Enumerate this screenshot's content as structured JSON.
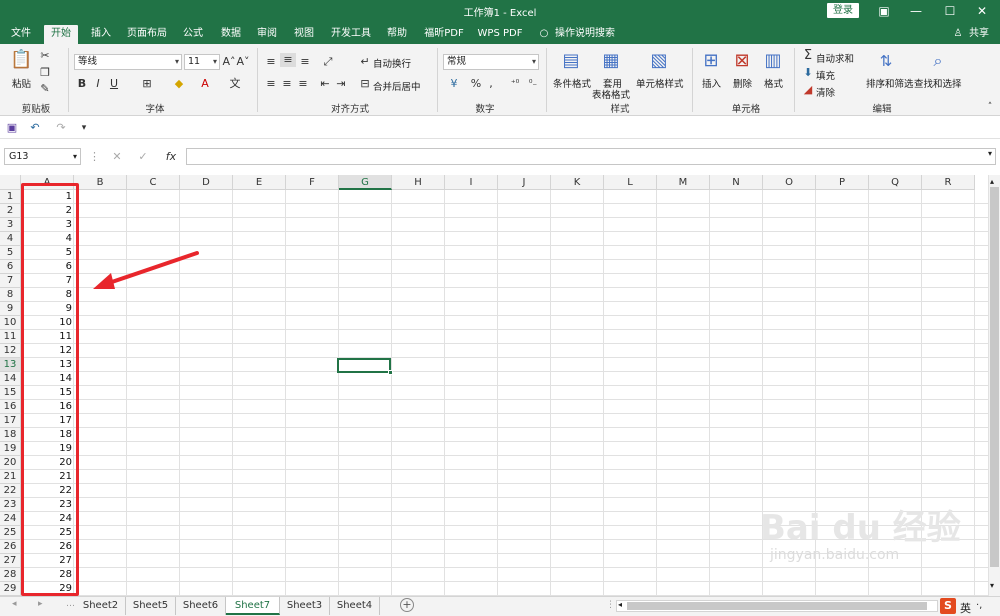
{
  "window": {
    "title": "工作簿1  -  Excel",
    "login_label": "登录",
    "accent": "#217346"
  },
  "menu_tabs": [
    {
      "label": "文件"
    },
    {
      "label": "开始"
    },
    {
      "label": "插入"
    },
    {
      "label": "页面布局"
    },
    {
      "label": "公式"
    },
    {
      "label": "数据"
    },
    {
      "label": "审阅"
    },
    {
      "label": "视图"
    },
    {
      "label": "开发工具"
    },
    {
      "label": "帮助"
    },
    {
      "label": "福昕PDF"
    },
    {
      "label": "WPS PDF"
    },
    {
      "label": "操作说明搜索"
    }
  ],
  "share_label": "共享",
  "ribbon": {
    "clipboard": {
      "paste": "粘贴",
      "group": "剪贴板"
    },
    "font": {
      "name": "等线",
      "size": "11",
      "group": "字体",
      "bold": "B",
      "italic": "I",
      "underline": "U"
    },
    "alignment": {
      "wrap": "自动换行",
      "merge": "合并后居中",
      "group": "对齐方式"
    },
    "number": {
      "format": "常规",
      "percent": "%",
      "comma": ",",
      "group": "数字"
    },
    "styles": {
      "cond": "条件格式",
      "table1": "套用",
      "table2": "表格格式",
      "cell_style": "单元格样式",
      "group": "样式"
    },
    "cells": {
      "insert": "插入",
      "delete": "删除",
      "format": "格式",
      "group": "单元格"
    },
    "editing": {
      "autosum": "自动求和",
      "fill": "填充",
      "clear": "清除",
      "sort": "排序和筛选",
      "find": "查找和选择",
      "group": "编辑"
    }
  },
  "formula_bar": {
    "name_box": "G13",
    "fx": "fx",
    "value": ""
  },
  "columns": [
    "A",
    "B",
    "C",
    "D",
    "E",
    "F",
    "G",
    "H",
    "I",
    "J",
    "K",
    "L",
    "M",
    "N",
    "O",
    "P",
    "Q",
    "R"
  ],
  "selected_column": "G",
  "selected_row": "13",
  "rows": [
    "1",
    "2",
    "3",
    "4",
    "5",
    "6",
    "7",
    "8",
    "9",
    "10",
    "11",
    "12",
    "13",
    "14",
    "15",
    "16",
    "17",
    "18",
    "19",
    "20",
    "21",
    "22",
    "23",
    "24",
    "25",
    "26",
    "27",
    "28",
    "29"
  ],
  "column_a_values": [
    "1",
    "2",
    "3",
    "4",
    "5",
    "6",
    "7",
    "8",
    "9",
    "10",
    "11",
    "12",
    "13",
    "14",
    "15",
    "16",
    "17",
    "18",
    "19",
    "20",
    "21",
    "22",
    "23",
    "24",
    "25",
    "26",
    "27",
    "28",
    "29"
  ],
  "sheets": [
    {
      "label": "Sheet2"
    },
    {
      "label": "Sheet5"
    },
    {
      "label": "Sheet6"
    },
    {
      "label": "Sheet7"
    },
    {
      "label": "Sheet3"
    },
    {
      "label": "Sheet4"
    }
  ],
  "active_sheet": "Sheet7",
  "watermark": {
    "logo": "Bai du 经验",
    "url": "jingyan.baidu.com"
  },
  "ime_label": "英",
  "annotation_color": "#e8262c"
}
